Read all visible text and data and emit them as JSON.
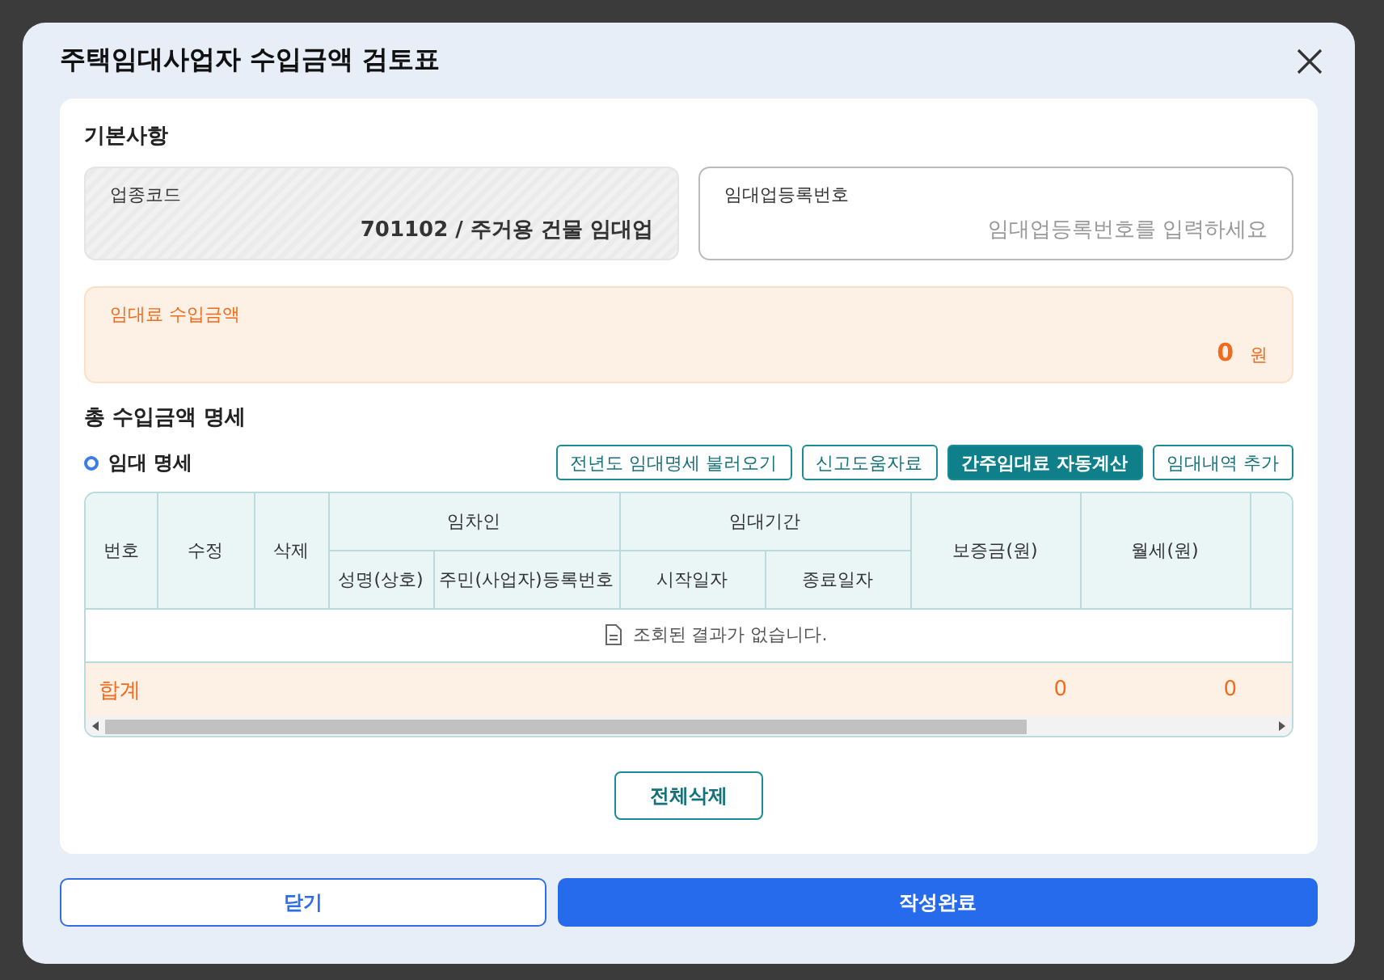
{
  "dialog": {
    "title": "주택임대사업자 수입금액 검토표"
  },
  "basic": {
    "heading": "기본사항",
    "fields": [
      {
        "label": "업종코드",
        "value": "701102 / 주거용 건물 임대업",
        "disabled": true
      },
      {
        "label": "임대업등록번호",
        "placeholder": "임대업등록번호를 입력하세요",
        "disabled": false
      }
    ],
    "income": {
      "label": "임대료 수입금액",
      "value": "0",
      "unit": "원"
    }
  },
  "detail": {
    "heading": "총 수입금액 명세",
    "subheading": "임대 명세",
    "buttons": [
      {
        "label": "전년도 임대명세 불러오기",
        "primary": false
      },
      {
        "label": "신고도움자료",
        "primary": false
      },
      {
        "label": "간주임대료 자동계산",
        "primary": true
      },
      {
        "label": "임대내역 추가",
        "primary": false
      }
    ],
    "table": {
      "columns": [
        {
          "label": "번호"
        },
        {
          "label": "수정"
        },
        {
          "label": "삭제"
        },
        {
          "label": "임차인",
          "children": [
            {
              "label": "성명(상호)"
            },
            {
              "label": "주민(사업자)등록번호"
            }
          ]
        },
        {
          "label": "임대기간",
          "children": [
            {
              "label": "시작일자"
            },
            {
              "label": "종료일자"
            }
          ]
        },
        {
          "label": "보증금(원)"
        },
        {
          "label": "월세(원)"
        },
        {}
      ],
      "empty_message": "조회된 결과가 없습니다.",
      "total_row": {
        "label": "합계",
        "deposit": "0",
        "rent": "0"
      }
    },
    "delete_all": "전체삭제"
  },
  "footer": {
    "buttons": [
      {
        "label": "닫기",
        "primary": false
      },
      {
        "label": "작성완료",
        "primary": true
      }
    ]
  }
}
